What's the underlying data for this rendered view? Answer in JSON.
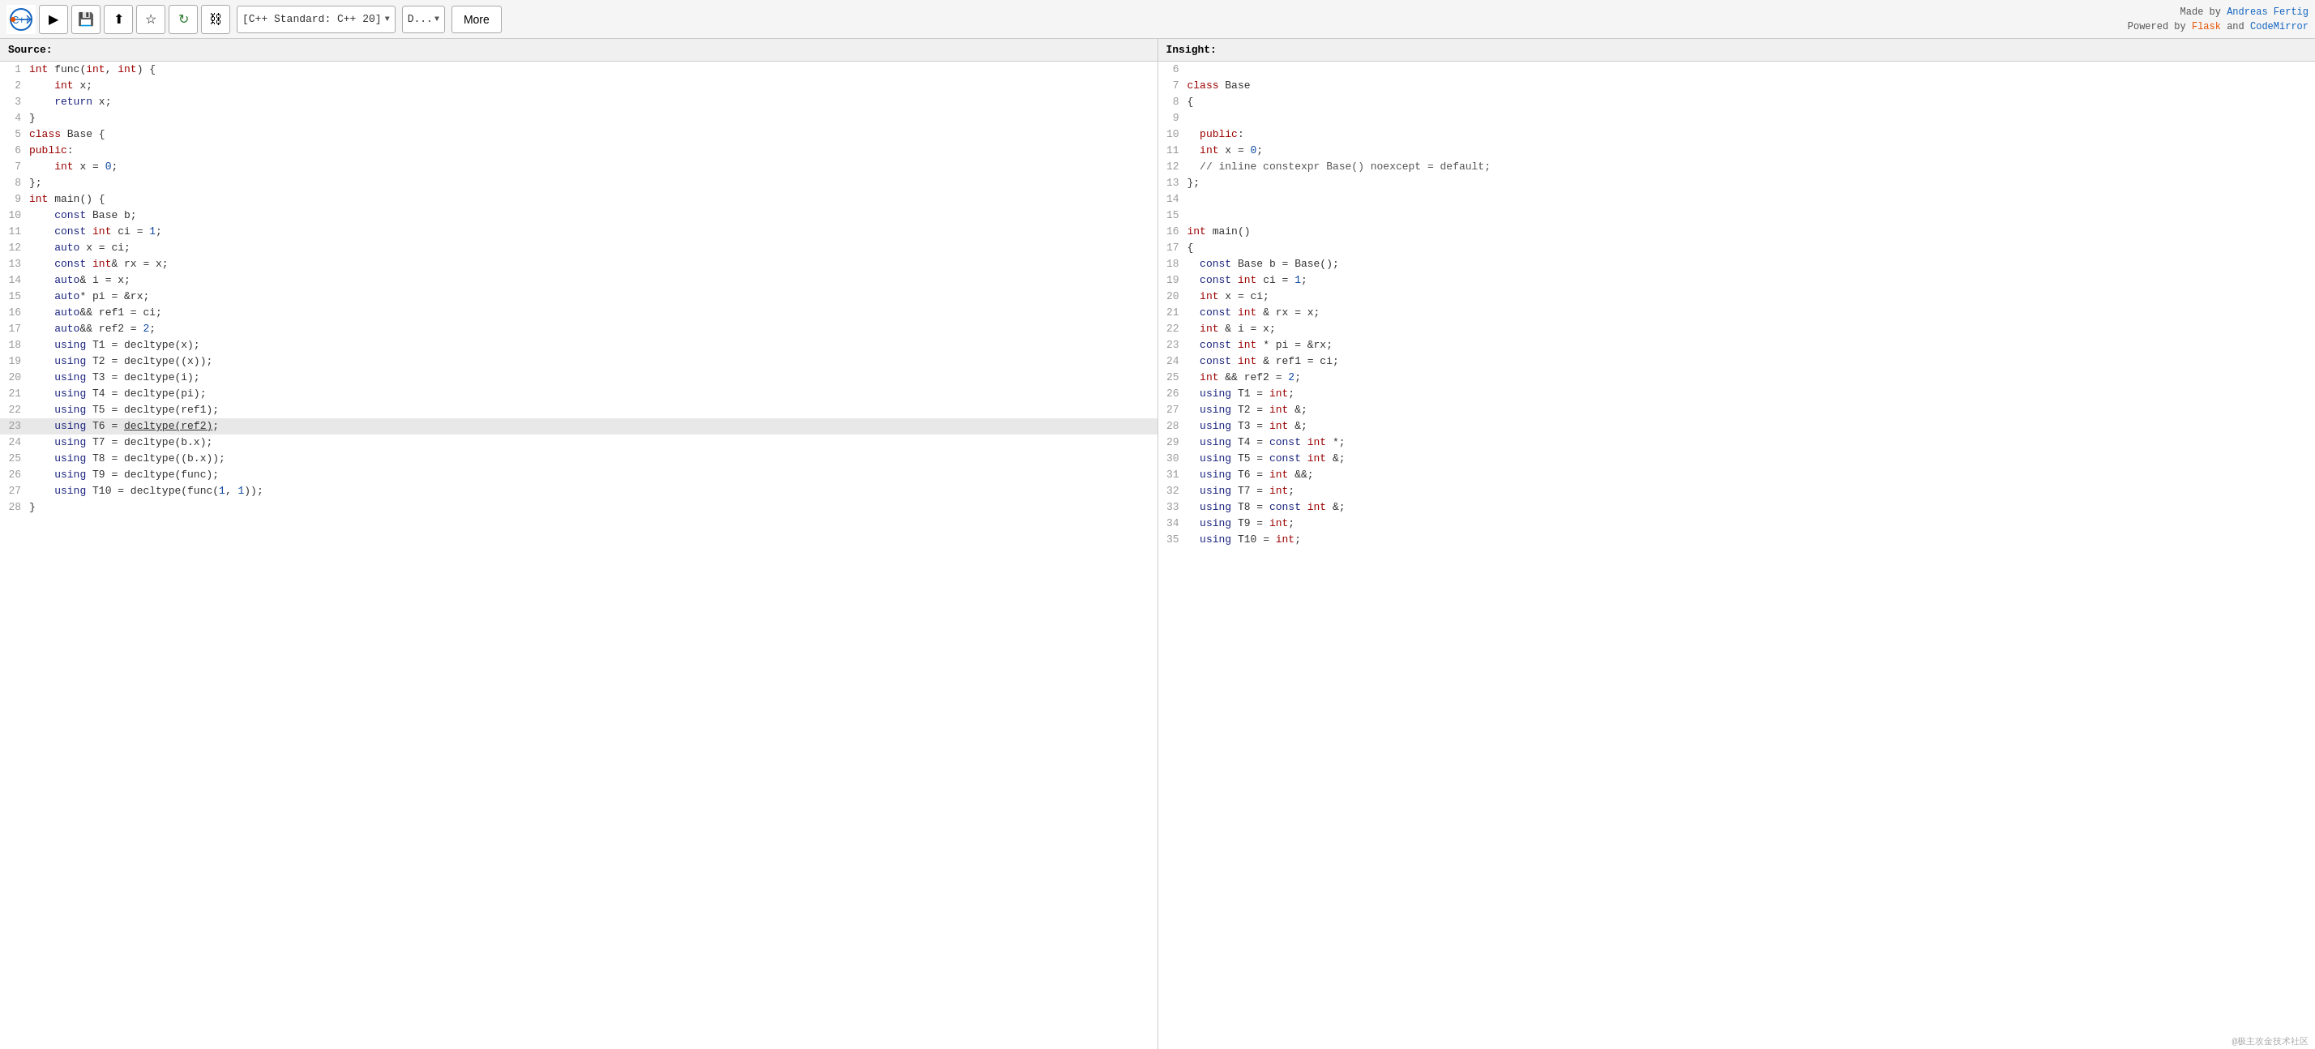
{
  "toolbar": {
    "logo_title": "C++ Insights Logo",
    "run_label": "▶",
    "save_label": "💾",
    "share_label": "⬆",
    "star_label": "★",
    "refresh_label": "↻",
    "link_label": "🔗",
    "std_select_text": "[C++ Standard: C++ 20]",
    "compiler_text": "D...",
    "more_label": "More",
    "credits_made": "Made by ",
    "credits_author": "Andreas Fertig",
    "credits_powered": "Powered by ",
    "credits_flask": "Flask",
    "credits_and": " and ",
    "credits_codemirror": "CodeMirror"
  },
  "source_panel": {
    "header": "Source:",
    "lines": [
      {
        "num": 1,
        "text": "int func(int, int) {",
        "highlight": false
      },
      {
        "num": 2,
        "text": "    int x;",
        "highlight": false
      },
      {
        "num": 3,
        "text": "    return x;",
        "highlight": false
      },
      {
        "num": 4,
        "text": "}",
        "highlight": false
      },
      {
        "num": 5,
        "text": "class Base {",
        "highlight": false
      },
      {
        "num": 6,
        "text": "public:",
        "highlight": false
      },
      {
        "num": 7,
        "text": "    int x = 0;",
        "highlight": false
      },
      {
        "num": 8,
        "text": "};",
        "highlight": false
      },
      {
        "num": 9,
        "text": "int main() {",
        "highlight": false
      },
      {
        "num": 10,
        "text": "    const Base b;",
        "highlight": false
      },
      {
        "num": 11,
        "text": "    const int ci = 1;",
        "highlight": false
      },
      {
        "num": 12,
        "text": "    auto x = ci;",
        "highlight": false
      },
      {
        "num": 13,
        "text": "    const int& rx = x;",
        "highlight": false
      },
      {
        "num": 14,
        "text": "    auto& i = x;",
        "highlight": false
      },
      {
        "num": 15,
        "text": "    auto* pi = &rx;",
        "highlight": false
      },
      {
        "num": 16,
        "text": "    auto&& ref1 = ci;",
        "highlight": false
      },
      {
        "num": 17,
        "text": "    auto&& ref2 = 2;",
        "highlight": false
      },
      {
        "num": 18,
        "text": "    using T1 = decltype(x);",
        "highlight": false
      },
      {
        "num": 19,
        "text": "    using T2 = decltype((x));",
        "highlight": false
      },
      {
        "num": 20,
        "text": "    using T3 = decltype(i);",
        "highlight": false
      },
      {
        "num": 21,
        "text": "    using T4 = decltype(pi);",
        "highlight": false
      },
      {
        "num": 22,
        "text": "    using T5 = decltype(ref1);",
        "highlight": false
      },
      {
        "num": 23,
        "text": "    using T6 = decltype(ref2);",
        "highlight": true
      },
      {
        "num": 24,
        "text": "    using T7 = decltype(b.x);",
        "highlight": false
      },
      {
        "num": 25,
        "text": "    using T8 = decltype((b.x));",
        "highlight": false
      },
      {
        "num": 26,
        "text": "    using T9 = decltype(func);",
        "highlight": false
      },
      {
        "num": 27,
        "text": "    using T10 = decltype(func(1, 1));",
        "highlight": false
      },
      {
        "num": 28,
        "text": "}",
        "highlight": false
      }
    ]
  },
  "insight_panel": {
    "header": "Insight:",
    "lines": [
      {
        "num": 6,
        "text": ""
      },
      {
        "num": 7,
        "text": "class Base"
      },
      {
        "num": 8,
        "text": "{"
      },
      {
        "num": 9,
        "text": ""
      },
      {
        "num": 10,
        "text": "  public:"
      },
      {
        "num": 11,
        "text": "  int x = 0;"
      },
      {
        "num": 12,
        "text": "  // inline constexpr Base() noexcept = default;"
      },
      {
        "num": 13,
        "text": "};"
      },
      {
        "num": 14,
        "text": ""
      },
      {
        "num": 15,
        "text": ""
      },
      {
        "num": 16,
        "text": "int main()"
      },
      {
        "num": 17,
        "text": "{"
      },
      {
        "num": 18,
        "text": "  const Base b = Base();"
      },
      {
        "num": 19,
        "text": "  const int ci = 1;"
      },
      {
        "num": 20,
        "text": "  int x = ci;"
      },
      {
        "num": 21,
        "text": "  const int & rx = x;"
      },
      {
        "num": 22,
        "text": "  int & i = x;"
      },
      {
        "num": 23,
        "text": "  const int * pi = &rx;"
      },
      {
        "num": 24,
        "text": "  const int & ref1 = ci;"
      },
      {
        "num": 25,
        "text": "  int && ref2 = 2;"
      },
      {
        "num": 26,
        "text": "  using T1 = int;"
      },
      {
        "num": 27,
        "text": "  using T2 = int &;"
      },
      {
        "num": 28,
        "text": "  using T3 = int &;"
      },
      {
        "num": 29,
        "text": "  using T4 = const int *;"
      },
      {
        "num": 30,
        "text": "  using T5 = const int &;"
      },
      {
        "num": 31,
        "text": "  using T6 = int &&;"
      },
      {
        "num": 32,
        "text": "  using T7 = int;"
      },
      {
        "num": 33,
        "text": "  using T8 = const int &;"
      },
      {
        "num": 34,
        "text": "  using T9 = int;"
      },
      {
        "num": 35,
        "text": "  using T10 = int;"
      }
    ]
  },
  "watermark": "@极主攻金技术社区"
}
